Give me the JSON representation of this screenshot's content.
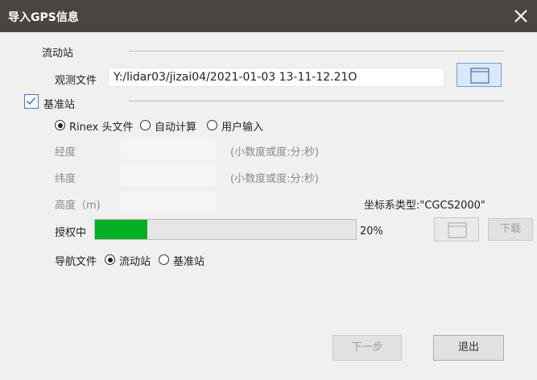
{
  "window": {
    "title": "导入GPS信息",
    "close_icon": "close-icon"
  },
  "rover": {
    "section_label": "流动站",
    "obs_file_label": "观测文件",
    "obs_file_path": "Y:/lidar03/jizai04/2021-01-03 13-11-12.21O",
    "browse_icon": "folder-icon"
  },
  "base": {
    "checkbox_label": "基准站",
    "checked": true,
    "radio_options": [
      {
        "label": "Rinex 头文件",
        "selected": true
      },
      {
        "label": "自动计算",
        "selected": false
      },
      {
        "label": "用户输入",
        "selected": false
      }
    ],
    "longitude_label": "经度",
    "longitude_hint": "(小数度或度:分:秒)",
    "latitude_label": "纬度",
    "latitude_hint": "(小数度或度:分:秒)",
    "height_label": "高度（m)",
    "coord_system": "坐标系类型:\"CGCS2000\""
  },
  "license": {
    "label": "授权中",
    "progress": 0.2,
    "percent_text": "20%",
    "download_label": "下载",
    "fill_color": "#06b025"
  },
  "nav": {
    "label": "导航文件",
    "options": [
      {
        "label": "流动站",
        "selected": true
      },
      {
        "label": "基准站",
        "selected": false
      }
    ]
  },
  "footer": {
    "next_label": "下一步",
    "exit_label": "退出"
  }
}
